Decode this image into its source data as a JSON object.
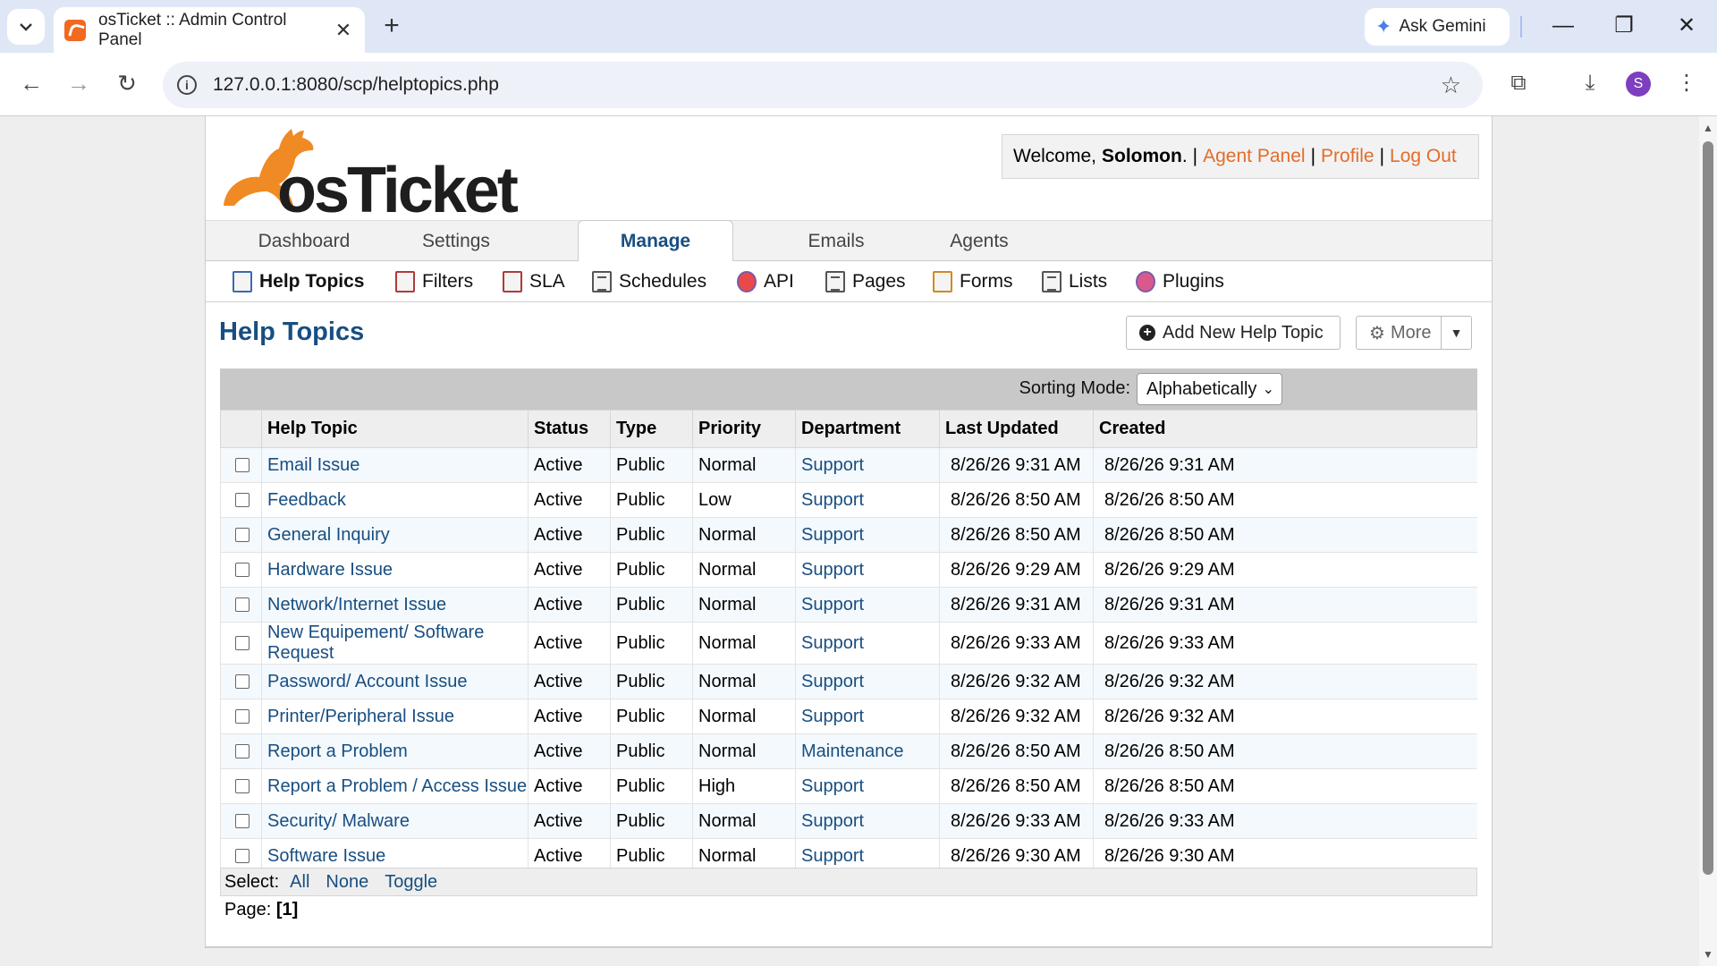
{
  "browser": {
    "tab_title": "osTicket :: Admin Control Panel",
    "gemini_label": "Ask Gemini",
    "url": "127.0.0.1:8080/scp/helptopics.php",
    "avatar_letter": "S"
  },
  "header": {
    "logo_text": "osTicket",
    "welcome_prefix": "Welcome,",
    "user_name": "Solomon",
    "agent_panel": "Agent Panel",
    "profile": "Profile",
    "logout": "Log Out"
  },
  "nav": {
    "tabs": [
      "Dashboard",
      "Settings",
      "Manage",
      "Emails",
      "Agents"
    ],
    "active": "Manage"
  },
  "subnav": {
    "items": [
      "Help Topics",
      "Filters",
      "SLA",
      "Schedules",
      "API",
      "Pages",
      "Forms",
      "Lists",
      "Plugins"
    ]
  },
  "content": {
    "page_title": "Help Topics",
    "add_button": "Add New Help Topic",
    "more_button": "More",
    "sorting_label": "Sorting Mode:",
    "sorting_value": "Alphabetically",
    "columns": [
      "Help Topic",
      "Status",
      "Type",
      "Priority",
      "Department",
      "Last Updated",
      "Created"
    ],
    "rows": [
      {
        "topic": "Email Issue",
        "status": "Active",
        "type": "Public",
        "priority": "Normal",
        "dept": "Support",
        "updated": "8/26/26 9:31 AM",
        "created": "8/26/26 9:31 AM"
      },
      {
        "topic": "Feedback",
        "status": "Active",
        "type": "Public",
        "priority": "Low",
        "dept": "Support",
        "updated": "8/26/26 8:50 AM",
        "created": "8/26/26 8:50 AM"
      },
      {
        "topic": "General Inquiry",
        "status": "Active",
        "type": "Public",
        "priority": "Normal",
        "dept": "Support",
        "updated": "8/26/26 8:50 AM",
        "created": "8/26/26 8:50 AM"
      },
      {
        "topic": "Hardware Issue",
        "status": "Active",
        "type": "Public",
        "priority": "Normal",
        "dept": "Support",
        "updated": "8/26/26 9:29 AM",
        "created": "8/26/26 9:29 AM"
      },
      {
        "topic": "Network/Internet Issue",
        "status": "Active",
        "type": "Public",
        "priority": "Normal",
        "dept": "Support",
        "updated": "8/26/26 9:31 AM",
        "created": "8/26/26 9:31 AM"
      },
      {
        "topic": "New Equipement/ Software Request",
        "status": "Active",
        "type": "Public",
        "priority": "Normal",
        "dept": "Support",
        "updated": "8/26/26 9:33 AM",
        "created": "8/26/26 9:33 AM"
      },
      {
        "topic": "Password/ Account Issue",
        "status": "Active",
        "type": "Public",
        "priority": "Normal",
        "dept": "Support",
        "updated": "8/26/26 9:32 AM",
        "created": "8/26/26 9:32 AM"
      },
      {
        "topic": "Printer/Peripheral Issue",
        "status": "Active",
        "type": "Public",
        "priority": "Normal",
        "dept": "Support",
        "updated": "8/26/26 9:32 AM",
        "created": "8/26/26 9:32 AM"
      },
      {
        "topic": "Report a Problem",
        "status": "Active",
        "type": "Public",
        "priority": "Normal",
        "dept": "Maintenance",
        "updated": "8/26/26 8:50 AM",
        "created": "8/26/26 8:50 AM"
      },
      {
        "topic": "Report a Problem / Access Issue",
        "status": "Active",
        "type": "Public",
        "priority": "High",
        "dept": "Support",
        "updated": "8/26/26 8:50 AM",
        "created": "8/26/26 8:50 AM"
      },
      {
        "topic": "Security/ Malware",
        "status": "Active",
        "type": "Public",
        "priority": "Normal",
        "dept": "Support",
        "updated": "8/26/26 9:33 AM",
        "created": "8/26/26 9:33 AM"
      },
      {
        "topic": "Software Issue",
        "status": "Active",
        "type": "Public",
        "priority": "Normal",
        "dept": "Support",
        "updated": "8/26/26 9:30 AM",
        "created": "8/26/26 9:30 AM"
      }
    ],
    "select_label": "Select:",
    "select_all": "All",
    "select_none": "None",
    "select_toggle": "Toggle",
    "page_label": "Page:",
    "page_current": "[1]"
  },
  "colors": {
    "link_blue": "#184e81",
    "accent_orange": "#e46c2a"
  }
}
